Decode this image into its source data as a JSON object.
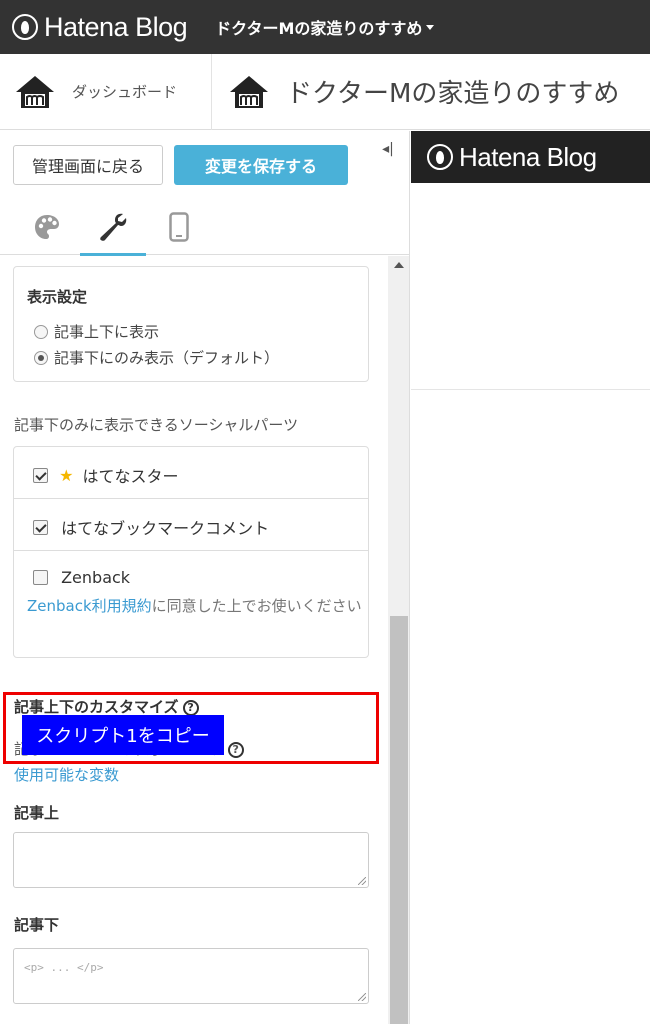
{
  "topbar": {
    "brand": "Hatena Blog",
    "blog_menu": "ドクターMの家造りのすすめ"
  },
  "secbar": {
    "dashboard_label": "ダッシュボード",
    "blog_title": "ドクターMの家造りのすすめ"
  },
  "panel": {
    "back_label": "管理画面に戻る",
    "save_label": "変更を保存する",
    "collapse_glyph": "◂|"
  },
  "display_settings": {
    "heading": "表示設定",
    "options": [
      {
        "label": "記事上下に表示",
        "selected": false
      },
      {
        "label": "記事下にのみ表示（デフォルト）",
        "selected": true
      }
    ]
  },
  "social": {
    "heading": "記事下のみに表示できるソーシャルパーツ",
    "items": [
      {
        "label": "はてなスター",
        "checked": true
      },
      {
        "label": "はてなブックマークコメント",
        "checked": true
      },
      {
        "label": "Zenback",
        "checked": false
      }
    ],
    "zenback_link": "Zenback利用規約",
    "zenback_note": "に同意した上でお使いください"
  },
  "custom": {
    "heading": "記事上下のカスタマイズ",
    "note": "記事ページにのみ表示されます",
    "vars_link": "使用可能な変数",
    "top_label": "記事上",
    "top_overlay": "スクリプト1をコピー",
    "bottom_label": "記事下",
    "bottom_placeholder": "<p> ... </p>"
  },
  "preview": {
    "brand": "Hatena Blog"
  },
  "colors": {
    "accent": "#4ab1d8",
    "highlight": "#ee0000",
    "overlay": "#0000ff",
    "star": "#f5b700"
  }
}
